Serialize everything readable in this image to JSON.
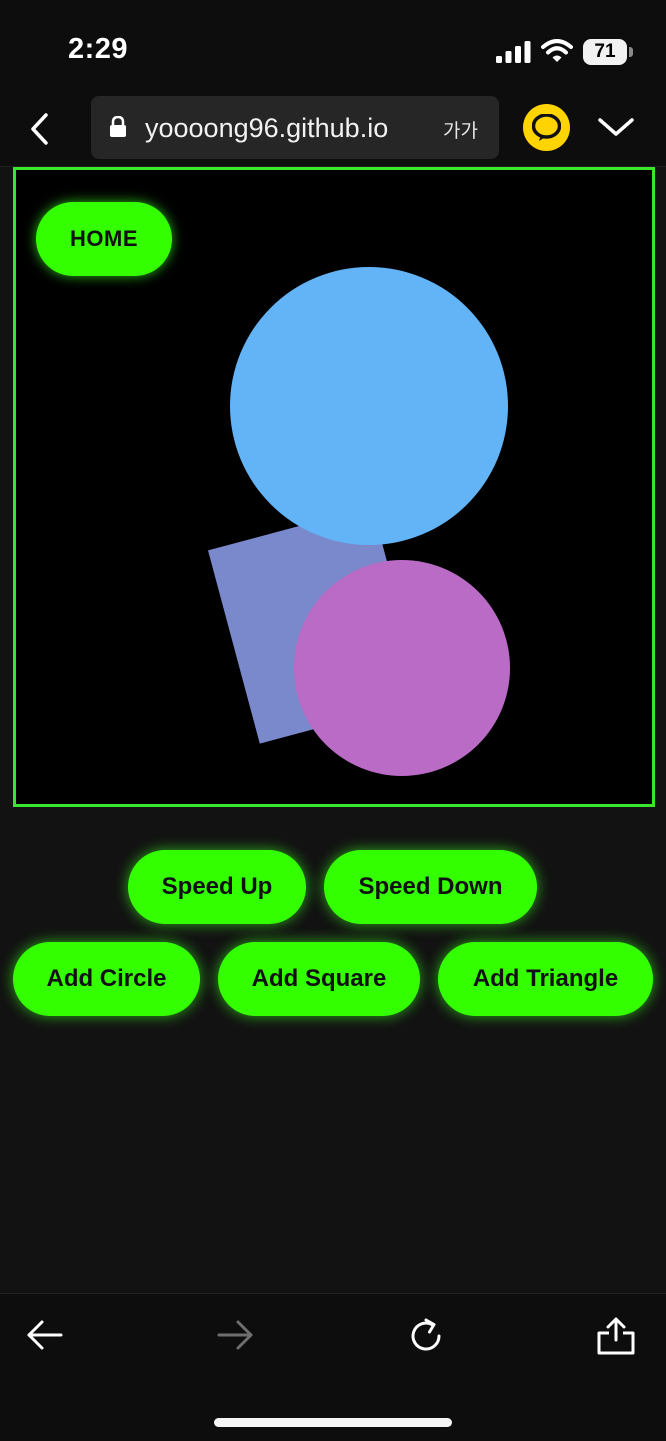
{
  "status_bar": {
    "time": "2:29",
    "battery": "71"
  },
  "browser": {
    "url": "yoooong96.github.io",
    "font_size_label": "가가"
  },
  "canvas": {
    "home_label": "HOME"
  },
  "controls": {
    "speed_up": "Speed Up",
    "speed_down": "Speed Down",
    "add_circle": "Add Circle",
    "add_square": "Add Square",
    "add_triangle": "Add Triangle"
  },
  "colors": {
    "accent": "#33ff00",
    "canvas_border": "#3ae62a",
    "circle_blue": "#62b4f6",
    "circle_purple": "#b96bc6",
    "square": "#7a88cc"
  },
  "icons": {
    "nav_back": "chevron-left-icon",
    "lock": "lock-icon",
    "kakao": "kakao-talk-icon",
    "menu": "chevron-down-icon",
    "toolbar_back": "arrow-left-icon",
    "toolbar_forward": "arrow-right-icon",
    "reload": "reload-icon",
    "share": "share-icon"
  }
}
